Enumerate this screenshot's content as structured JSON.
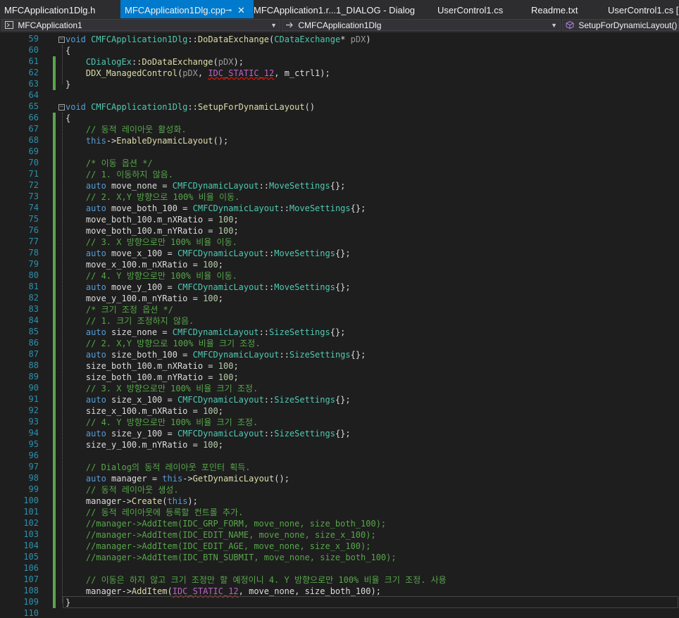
{
  "tabs": [
    {
      "label": "MFCApplication1Dlg.h",
      "active": false
    },
    {
      "label": "MFCApplication1Dlg.cpp",
      "active": true
    },
    {
      "label": "MFCApplication1.r...1_DIALOG - Dialog",
      "active": false
    },
    {
      "label": "UserControl1.cs",
      "active": false
    },
    {
      "label": "Readme.txt",
      "active": false
    },
    {
      "label": "UserControl1.cs [",
      "active": false
    }
  ],
  "tab_pin_glyph": "⊸",
  "tab_close_glyph": "✕",
  "nav": {
    "project": "MFCApplication1",
    "scope": "CMFCApplication1Dlg",
    "member": "SetupForDynamicLayout()"
  },
  "colors": {
    "accent": "#007acc",
    "background": "#1e1e1e",
    "line_number": "#2b91af",
    "change_bar": "#57a64a"
  },
  "lines": [
    {
      "n": "59",
      "code": "void CMFCApplication1Dlg::DoDataExchange(CDataExchange* pDX)"
    },
    {
      "n": "60",
      "code": "{"
    },
    {
      "n": "61",
      "code": "    CDialogEx::DoDataExchange(pDX);"
    },
    {
      "n": "62",
      "code": "    DDX_ManagedControl(pDX, IDC_STATIC_12, m_ctrl1);"
    },
    {
      "n": "63",
      "code": "}"
    },
    {
      "n": "64",
      "code": ""
    },
    {
      "n": "65",
      "code": "void CMFCApplication1Dlg::SetupForDynamicLayout()"
    },
    {
      "n": "66",
      "code": "{"
    },
    {
      "n": "67",
      "code": "    // 동적 레이아웃 활성화."
    },
    {
      "n": "68",
      "code": "    this->EnableDynamicLayout();"
    },
    {
      "n": "69",
      "code": ""
    },
    {
      "n": "70",
      "code": "    /* 이동 옵션 */"
    },
    {
      "n": "71",
      "code": "    // 1. 이동하지 않음."
    },
    {
      "n": "72",
      "code": "    auto move_none = CMFCDynamicLayout::MoveSettings{};"
    },
    {
      "n": "73",
      "code": "    // 2. X,Y 방향으로 100% 비율 이동."
    },
    {
      "n": "74",
      "code": "    auto move_both_100 = CMFCDynamicLayout::MoveSettings{};"
    },
    {
      "n": "75",
      "code": "    move_both_100.m_nXRatio = 100;"
    },
    {
      "n": "76",
      "code": "    move_both_100.m_nYRatio = 100;"
    },
    {
      "n": "77",
      "code": "    // 3. X 방향으로만 100% 비율 이동."
    },
    {
      "n": "78",
      "code": "    auto move_x_100 = CMFCDynamicLayout::MoveSettings{};"
    },
    {
      "n": "79",
      "code": "    move_x_100.m_nXRatio = 100;"
    },
    {
      "n": "80",
      "code": "    // 4. Y 방향으로만 100% 비율 이동."
    },
    {
      "n": "81",
      "code": "    auto move_y_100 = CMFCDynamicLayout::MoveSettings{};"
    },
    {
      "n": "82",
      "code": "    move_y_100.m_nYRatio = 100;"
    },
    {
      "n": "83",
      "code": "    /* 크기 조정 옵션 */"
    },
    {
      "n": "84",
      "code": "    // 1. 크기 조정하지 않음."
    },
    {
      "n": "85",
      "code": "    auto size_none = CMFCDynamicLayout::SizeSettings{};"
    },
    {
      "n": "86",
      "code": "    // 2. X,Y 방향으로 100% 비율 크기 조정."
    },
    {
      "n": "87",
      "code": "    auto size_both_100 = CMFCDynamicLayout::SizeSettings{};"
    },
    {
      "n": "88",
      "code": "    size_both_100.m_nXRatio = 100;"
    },
    {
      "n": "89",
      "code": "    size_both_100.m_nYRatio = 100;"
    },
    {
      "n": "90",
      "code": "    // 3. X 방향으로만 100% 비율 크기 조정."
    },
    {
      "n": "91",
      "code": "    auto size_x_100 = CMFCDynamicLayout::SizeSettings{};"
    },
    {
      "n": "92",
      "code": "    size_x_100.m_nXRatio = 100;"
    },
    {
      "n": "93",
      "code": "    // 4. Y 방향으로만 100% 비율 크기 조정."
    },
    {
      "n": "94",
      "code": "    auto size_y_100 = CMFCDynamicLayout::SizeSettings{};"
    },
    {
      "n": "95",
      "code": "    size_y_100.m_nYRatio = 100;"
    },
    {
      "n": "96",
      "code": ""
    },
    {
      "n": "97",
      "code": "    // Dialog의 동적 레이아웃 포인터 획득."
    },
    {
      "n": "98",
      "code": "    auto manager = this->GetDynamicLayout();"
    },
    {
      "n": "99",
      "code": "    // 동적 레이아웃 생성."
    },
    {
      "n": "100",
      "code": "    manager->Create(this);"
    },
    {
      "n": "101",
      "code": "    // 동적 레이아웃에 등록할 컨트롤 추가."
    },
    {
      "n": "102",
      "code": "    //manager->AddItem(IDC_GRP_FORM, move_none, size_both_100);"
    },
    {
      "n": "103",
      "code": "    //manager->AddItem(IDC_EDIT_NAME, move_none, size_x_100);"
    },
    {
      "n": "104",
      "code": "    //manager->AddItem(IDC_EDIT_AGE, move_none, size_x_100);"
    },
    {
      "n": "105",
      "code": "    //manager->AddItem(IDC_BTN_SUBMIT, move_none, size_both_100);"
    },
    {
      "n": "106",
      "code": ""
    },
    {
      "n": "107",
      "code": "    // 이동은 하지 않고 크기 조정만 할 예정이니 4. Y 방향으로만 100% 비율 크기 조정. 사용"
    },
    {
      "n": "108",
      "code": "    manager->AddItem(IDC_STATIC_12, move_none, size_both_100);"
    },
    {
      "n": "109",
      "code": "}"
    },
    {
      "n": "110",
      "code": ""
    }
  ]
}
